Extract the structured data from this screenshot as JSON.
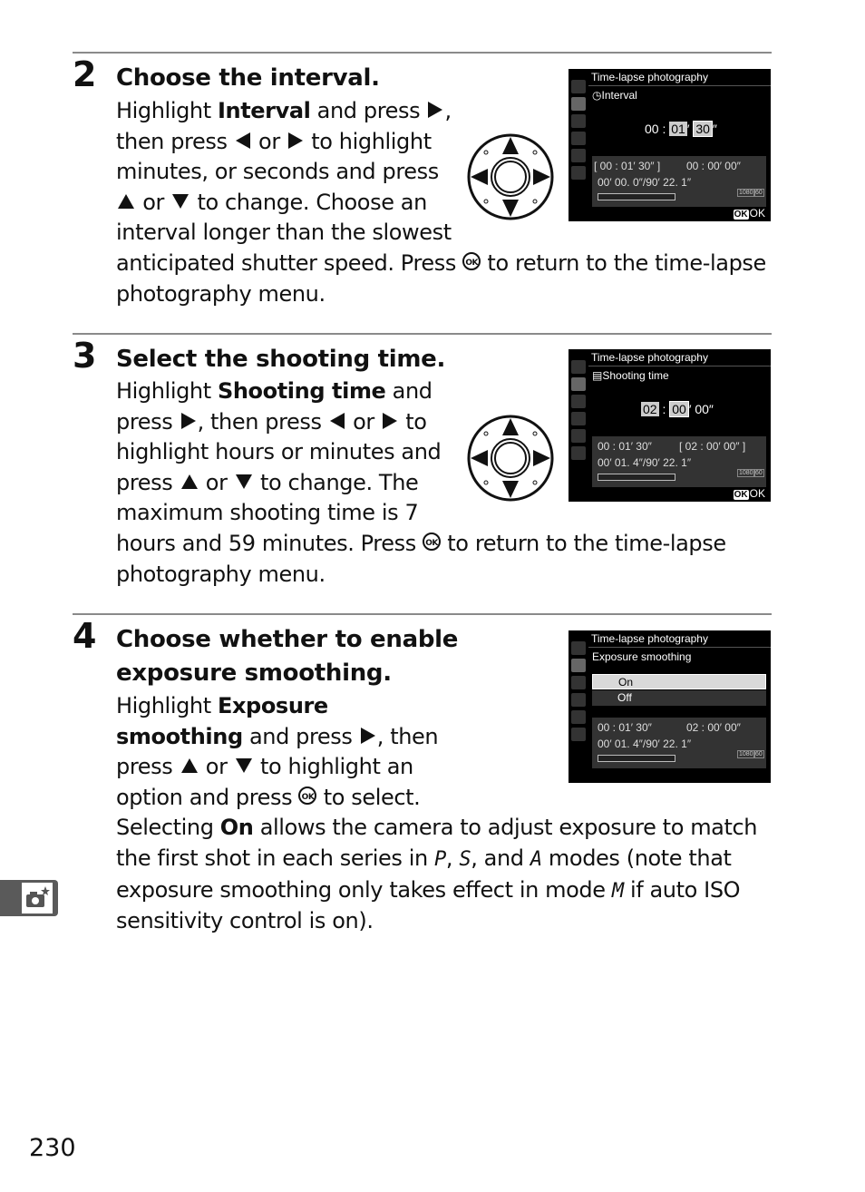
{
  "steps": [
    {
      "number": "2",
      "title": "Choose the interval.",
      "lines": [
        {
          "pre": "Highlight ",
          "bold": "Interval",
          "post": " and press ",
          "sym1": "right",
          ",": ","
        },
        {
          "text": "then press ",
          "sym1": "left",
          "mid": " or ",
          "sym2": "right",
          "post": " to highlight"
        },
        {
          "text": "minutes, or seconds and press"
        },
        {
          "sym1": "up",
          "mid": " or ",
          "sym2": "down",
          "post": " to change.  Choose an"
        },
        {
          "text": "interval longer than the slowest"
        },
        {
          "text": "anticipated shutter speed.  Press ",
          "ok": true,
          "post": " to return to the time-lapse"
        },
        {
          "text": "photography menu."
        }
      ],
      "screen": {
        "header": "Time-lapse photography",
        "subtitle": "Interval",
        "subtitle_icon": "interval-timer-icon",
        "time_fields": [
          "00",
          "01",
          "30"
        ],
        "time_units": [
          ":",
          "′",
          "″"
        ],
        "highlighted": [
          1
        ],
        "selected": 2,
        "info_line1_left": "[ 00 : 01′ 30″ ]",
        "info_line1_right": "00 : 00′ 00″",
        "info_line2": "00′ 00. 0″/90′ 22. 1″",
        "ok_label": "OK",
        "tag1": "1080",
        "tag2": "60"
      }
    },
    {
      "number": "3",
      "title": "Select the shooting time.",
      "screen": {
        "header": "Time-lapse photography",
        "subtitle": "Shooting time",
        "subtitle_icon": "shooting-time-icon",
        "time_fields": [
          "02",
          "00",
          "00"
        ],
        "info_line1_left": "00 : 01′ 30″",
        "info_line1_right": "[ 02 : 00′ 00″ ]",
        "info_line2": "00′ 01. 4″/90′ 22. 1″",
        "ok_label": "OK",
        "tag1": "1080",
        "tag2": "60"
      }
    },
    {
      "number": "4",
      "title_line1": "Choose whether to enable",
      "title_line2": "exposure smoothing.",
      "screen": {
        "header": "Time-lapse photography",
        "subtitle": "Exposure smoothing",
        "options": [
          "On",
          "Off"
        ],
        "selected_option": "On",
        "info_line1_left": "00 : 01′ 30″",
        "info_line1_right": "02 : 00′ 00″",
        "info_line2": "00′ 01. 4″/90′ 22. 1″",
        "tag1": "1080",
        "tag2": "60"
      }
    }
  ],
  "text": {
    "s2": {
      "l1a": "Highlight ",
      "l1b": "Interval",
      "l1c": " and press ",
      "l1d": ",",
      "l2a": "then press ",
      "l2b": " or ",
      "l2c": " to highlight",
      "l3": "minutes, or seconds and press",
      "l4a": " or ",
      "l4b": " to change.  Choose an",
      "l5": "interval longer than the slowest",
      "l6a": "anticipated shutter speed.  Press ",
      "l6b": " to return to the time-lapse",
      "l7": "photography menu."
    },
    "s3": {
      "l1a": "Highlight ",
      "l1b": "Shooting time",
      "l1c": " and",
      "l2a": "press ",
      "l2b": ", then press ",
      "l2c": " or ",
      "l2d": " to",
      "l3": "highlight hours or minutes and",
      "l4a": "press ",
      "l4b": " or ",
      "l4c": " to change.  The",
      "l5": "maximum shooting time is 7",
      "l6a": "hours and 59 minutes.  Press ",
      "l6b": " to return to the time-lapse",
      "l7": "photography menu."
    },
    "s4": {
      "l1a": "Highlight ",
      "l1b": "Exposure",
      "l2a": "smoothing",
      "l2b": " and press ",
      "l2c": ", then",
      "l3a": "press ",
      "l3b": " or ",
      "l3c": " to highlight an",
      "l4a": "option and press ",
      "l4b": " to select.",
      "l5a": "Selecting ",
      "l5b": "On",
      "l5c": " allows the camera to adjust exposure to match",
      "l6a": "the first shot in each series in ",
      "l6b": "P",
      "l6c": ", ",
      "l6d": "S",
      "l6e": ", and ",
      "l6f": "A",
      "l6g": " modes (note that",
      "l7a": "exposure smoothing only takes effect in mode ",
      "l7b": "M",
      "l7c": " if auto ISO",
      "l8": "sensitivity control is on)."
    },
    "ok_symbol": "OK"
  },
  "side_tab": {
    "icon": "camera-star-icon"
  },
  "page_number": "230"
}
